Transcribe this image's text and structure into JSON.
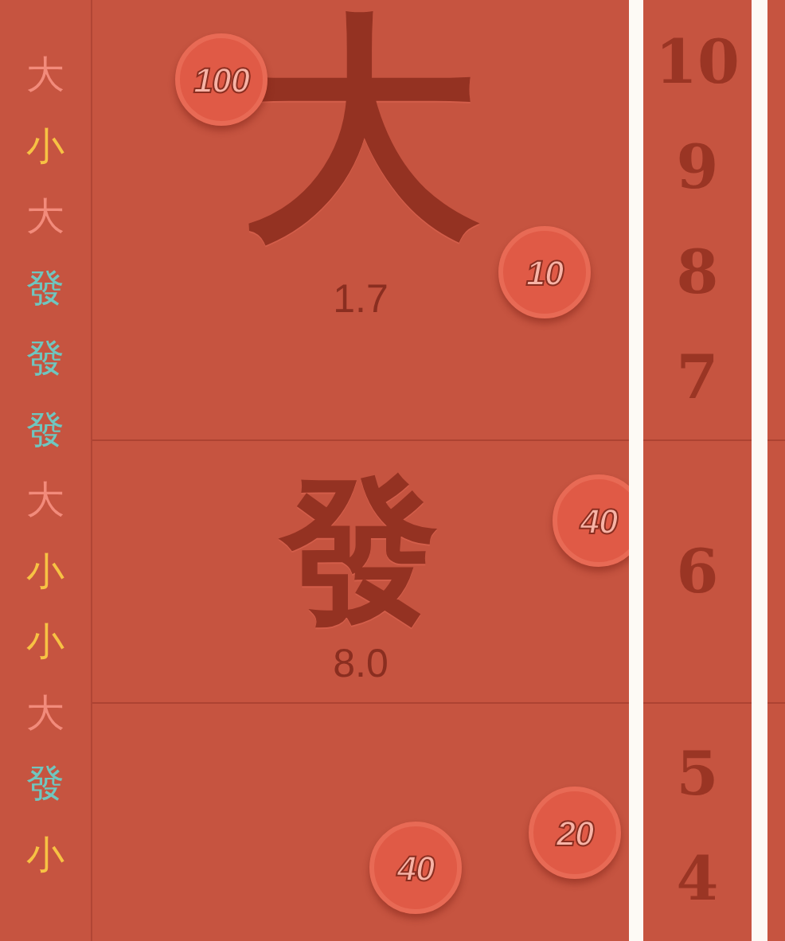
{
  "history": [
    {
      "char": "大",
      "color": "#f28b7b"
    },
    {
      "char": "小",
      "color": "#f7c244"
    },
    {
      "char": "大",
      "color": "#f28b7b"
    },
    {
      "char": "發",
      "color": "#6fc6bf"
    },
    {
      "char": "發",
      "color": "#6fc6bf"
    },
    {
      "char": "發",
      "color": "#6fc6bf"
    },
    {
      "char": "大",
      "color": "#f28b7b"
    },
    {
      "char": "小",
      "color": "#f7c244"
    },
    {
      "char": "小",
      "color": "#f7c244"
    },
    {
      "char": "大",
      "color": "#f28b7b"
    },
    {
      "char": "發",
      "color": "#6fc6bf"
    },
    {
      "char": "小",
      "color": "#f7c244"
    }
  ],
  "bets": [
    {
      "char": "大",
      "odds": "1.7",
      "chips": [
        "100",
        "10"
      ],
      "numbers": [
        "10",
        "9",
        "8",
        "7"
      ]
    },
    {
      "char": "發",
      "odds": "8.0",
      "chips": [
        "40"
      ],
      "numbers": [
        "6"
      ]
    },
    {
      "chips": [
        "20",
        "40"
      ],
      "numbers": [
        "5",
        "4"
      ]
    }
  ]
}
